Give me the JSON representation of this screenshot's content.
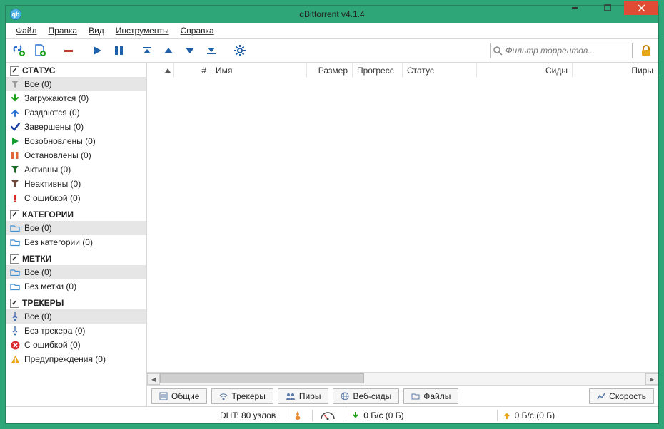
{
  "title": "qBittorrent v4.1.4",
  "menu": [
    "Файл",
    "Правка",
    "Вид",
    "Инструменты",
    "Справка"
  ],
  "search_placeholder": "Фильтр торрентов...",
  "sidebar": {
    "status": {
      "header": "СТАТУС",
      "items": [
        {
          "icon": "funnel",
          "color": "#9a9a9a",
          "label": "Все (0)"
        },
        {
          "icon": "down",
          "color": "#1a9f1a",
          "label": "Загружаются (0)"
        },
        {
          "icon": "up",
          "color": "#2a6fd1",
          "label": "Раздаются (0)"
        },
        {
          "icon": "check",
          "color": "#1a3da3",
          "label": "Завершены (0)"
        },
        {
          "icon": "play",
          "color": "#129b2f",
          "label": "Возобновлены (0)"
        },
        {
          "icon": "pause",
          "color": "#e0653a",
          "label": "Остановлены (0)"
        },
        {
          "icon": "funnel",
          "color": "#1b6b22",
          "label": "Активны (0)"
        },
        {
          "icon": "funnel",
          "color": "#6b4a3a",
          "label": "Неактивны (0)"
        },
        {
          "icon": "error",
          "color": "#d92b2b",
          "label": "С ошибкой (0)"
        }
      ]
    },
    "categories": {
      "header": "КАТЕГОРИИ",
      "items": [
        {
          "icon": "folder",
          "color": "#3f8fd1",
          "label": "Все (0)"
        },
        {
          "icon": "folder",
          "color": "#3f8fd1",
          "label": "Без категории (0)"
        }
      ]
    },
    "labels": {
      "header": "МЕТКИ",
      "items": [
        {
          "icon": "folder",
          "color": "#3f8fd1",
          "label": "Все (0)"
        },
        {
          "icon": "folder",
          "color": "#3f8fd1",
          "label": "Без метки (0)"
        }
      ]
    },
    "trackers": {
      "header": "ТРЕКЕРЫ",
      "items": [
        {
          "icon": "tracker",
          "color": "#3f6fb1",
          "label": "Все (0)"
        },
        {
          "icon": "tracker",
          "color": "#3f6fb1",
          "label": "Без трекера (0)"
        },
        {
          "icon": "circle-x",
          "color": "#d92b2b",
          "label": "С ошибкой (0)"
        },
        {
          "icon": "warn",
          "color": "#e8a617",
          "label": "Предупреждения (0)"
        }
      ]
    }
  },
  "columns": [
    "#",
    "Имя",
    "Размер",
    "Прогресс",
    "Статус",
    "Сиды",
    "Пиры"
  ],
  "tabs": {
    "general": "Общие",
    "trackers": "Трекеры",
    "peers": "Пиры",
    "webseeds": "Веб-сиды",
    "files": "Файлы",
    "speed": "Скорость"
  },
  "status": {
    "dht": "DHT: 80 узлов",
    "down": "0 Б/с (0 Б)",
    "up": "0 Б/с (0 Б)"
  }
}
